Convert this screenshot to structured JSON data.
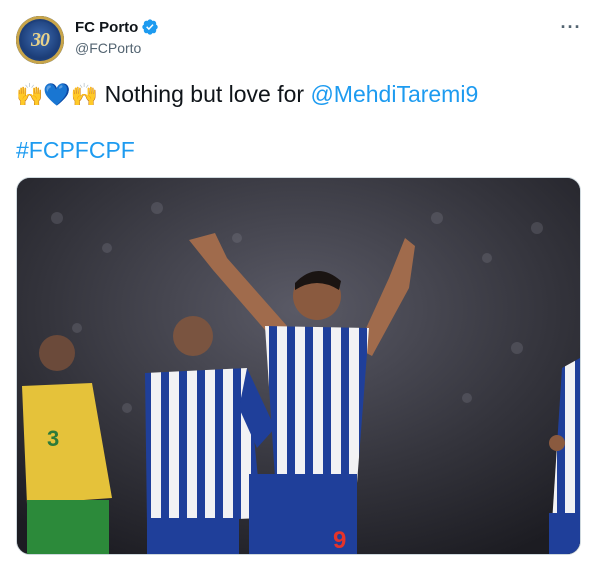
{
  "account": {
    "display_name": "FC Porto",
    "handle": "@FCPorto",
    "verified": true,
    "avatar_mark": "30"
  },
  "tweet": {
    "emojis": [
      "raising-hands",
      "blue-heart",
      "raising-hands"
    ],
    "text": "Nothing but love for ",
    "mention": "@MehdiTaremi9",
    "hashtag": "#FCPFCPF"
  },
  "photo": {
    "description": "Player celebrating with arms raised",
    "jersey_numbers": [
      "9",
      "3"
    ]
  },
  "colors": {
    "link": "#1d9bf0",
    "porto_blue": "#1f3f9a",
    "away_yellow": "#e5c23a",
    "away_green": "#2c8a3a"
  }
}
